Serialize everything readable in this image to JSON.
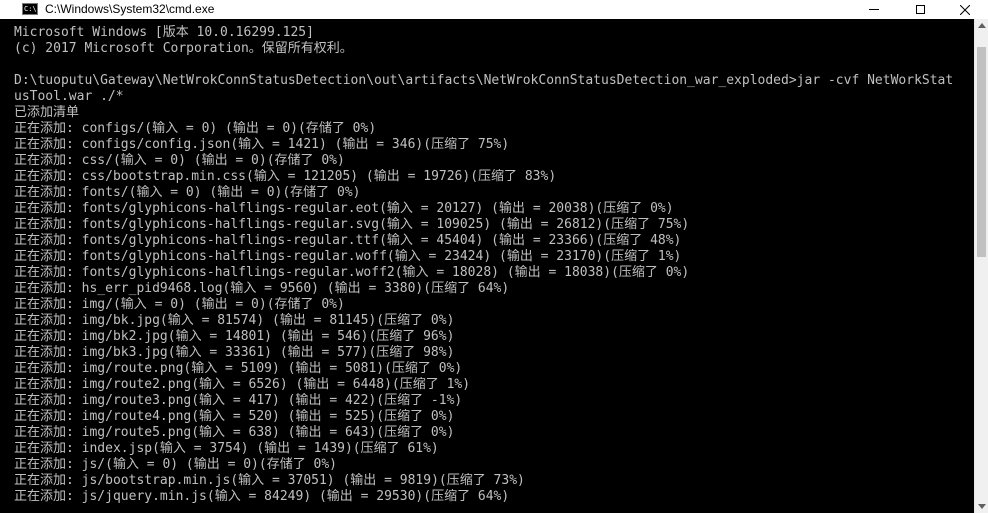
{
  "window": {
    "title": "C:\\Windows\\System32\\cmd.exe",
    "icon": "cmd-icon",
    "icon_text": "C:\\"
  },
  "controls": {
    "minimize": "minimize-icon",
    "maximize": "maximize-icon",
    "close_label": "✕"
  },
  "console": {
    "lines": [
      "Microsoft Windows [版本 10.0.16299.125]",
      "(c) 2017 Microsoft Corporation。保留所有权利。",
      "",
      "D:\\tuoputu\\Gateway\\NetWrokConnStatusDetection\\out\\artifacts\\NetWrokConnStatusDetection_war_exploded>jar -cvf NetWorkStat",
      "usTool.war ./*",
      "已添加清单",
      "正在添加: configs/(输入 = 0) (输出 = 0)(存储了 0%)",
      "正在添加: configs/config.json(输入 = 1421) (输出 = 346)(压缩了 75%)",
      "正在添加: css/(输入 = 0) (输出 = 0)(存储了 0%)",
      "正在添加: css/bootstrap.min.css(输入 = 121205) (输出 = 19726)(压缩了 83%)",
      "正在添加: fonts/(输入 = 0) (输出 = 0)(存储了 0%)",
      "正在添加: fonts/glyphicons-halflings-regular.eot(输入 = 20127) (输出 = 20038)(压缩了 0%)",
      "正在添加: fonts/glyphicons-halflings-regular.svg(输入 = 109025) (输出 = 26812)(压缩了 75%)",
      "正在添加: fonts/glyphicons-halflings-regular.ttf(输入 = 45404) (输出 = 23366)(压缩了 48%)",
      "正在添加: fonts/glyphicons-halflings-regular.woff(输入 = 23424) (输出 = 23170)(压缩了 1%)",
      "正在添加: fonts/glyphicons-halflings-regular.woff2(输入 = 18028) (输出 = 18038)(压缩了 0%)",
      "正在添加: hs_err_pid9468.log(输入 = 9560) (输出 = 3380)(压缩了 64%)",
      "正在添加: img/(输入 = 0) (输出 = 0)(存储了 0%)",
      "正在添加: img/bk.jpg(输入 = 81574) (输出 = 81145)(压缩了 0%)",
      "正在添加: img/bk2.jpg(输入 = 14801) (输出 = 546)(压缩了 96%)",
      "正在添加: img/bk3.jpg(输入 = 33361) (输出 = 577)(压缩了 98%)",
      "正在添加: img/route.png(输入 = 5109) (输出 = 5081)(压缩了 0%)",
      "正在添加: img/route2.png(输入 = 6526) (输出 = 6448)(压缩了 1%)",
      "正在添加: img/route3.png(输入 = 417) (输出 = 422)(压缩了 -1%)",
      "正在添加: img/route4.png(输入 = 520) (输出 = 525)(压缩了 0%)",
      "正在添加: img/route5.png(输入 = 638) (输出 = 643)(压缩了 0%)",
      "正在添加: index.jsp(输入 = 3754) (输出 = 1439)(压缩了 61%)",
      "正在添加: js/(输入 = 0) (输出 = 0)(存储了 0%)",
      "正在添加: js/bootstrap.min.js(输入 = 37051) (输出 = 9819)(压缩了 73%)",
      "正在添加: js/jquery.min.js(输入 = 84249) (输出 = 29530)(压缩了 64%)"
    ]
  },
  "colors": {
    "console_background": "#000000",
    "console_text": "#c0c0c0",
    "titlebar_background": "#ffffff"
  }
}
